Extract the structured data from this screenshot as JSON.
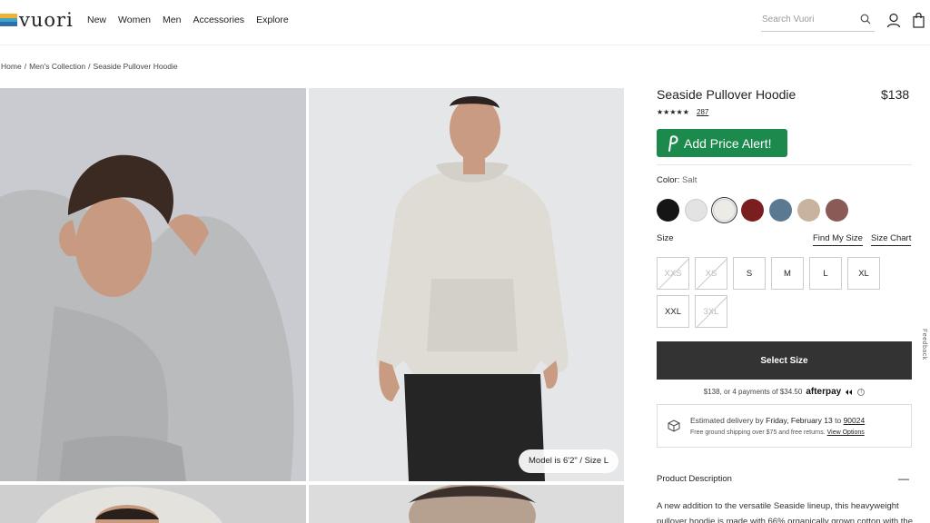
{
  "brand": {
    "name": "vuori",
    "logo_colors": [
      "#f2b134",
      "#3fa3c9",
      "#2f6fa8"
    ]
  },
  "nav": [
    "New",
    "Women",
    "Men",
    "Accessories",
    "Explore"
  ],
  "search": {
    "placeholder": "Search Vuori"
  },
  "icons": {
    "search": "search-icon",
    "account": "user-icon",
    "bag": "shopping-bag-icon"
  },
  "breadcrumb": [
    "Home",
    "Men's Collection",
    "Seaside Pullover Hoodie"
  ],
  "gallery": {
    "model_badge": "Model is 6'2\" / Size L"
  },
  "product": {
    "title": "Seaside Pullover Hoodie",
    "price": "$138",
    "rating": 4.5,
    "stars": "★★★★★",
    "review_count": "287",
    "price_alert": "Add Price Alert!",
    "color_label": "Color:",
    "color_value": "Salt",
    "swatches": [
      {
        "name": "black",
        "color": "#151515"
      },
      {
        "name": "heather-grey",
        "color": "#e3e3e3"
      },
      {
        "name": "salt",
        "color": "#ecebe6",
        "selected": true
      },
      {
        "name": "burgundy",
        "color": "#7b1e20"
      },
      {
        "name": "slate-blue",
        "color": "#5b7990"
      },
      {
        "name": "oatmeal",
        "color": "#c7b39e"
      },
      {
        "name": "mauve",
        "color": "#8a5a57"
      }
    ],
    "size_label": "Size",
    "find_my_size": "Find My Size",
    "size_chart": "Size Chart",
    "sizes": [
      {
        "label": "XXS",
        "available": false
      },
      {
        "label": "XS",
        "available": false
      },
      {
        "label": "S",
        "available": true
      },
      {
        "label": "M",
        "available": true
      },
      {
        "label": "L",
        "available": true
      },
      {
        "label": "XL",
        "available": true
      },
      {
        "label": "XXL",
        "available": true
      },
      {
        "label": "3XL",
        "available": false
      }
    ],
    "select_button": "Select Size",
    "afterpay_text": "$138, or 4 payments of $34.50",
    "afterpay_brand": "afterpay",
    "afterpay_info": "i",
    "delivery": {
      "prefix": "Estimated delivery by",
      "date": "Friday, February 13",
      "to": "to",
      "zip": "90024",
      "shipping": "Free ground shipping over $75 and free returns.",
      "view_options": "View Options"
    },
    "description_title": "Product Description",
    "description_toggle": "—",
    "description_text": "A new addition to the versatile Seaside lineup, this heavyweight pullover hoodie is made with 66% organically grown cotton with the"
  },
  "feedback": "Feedback"
}
